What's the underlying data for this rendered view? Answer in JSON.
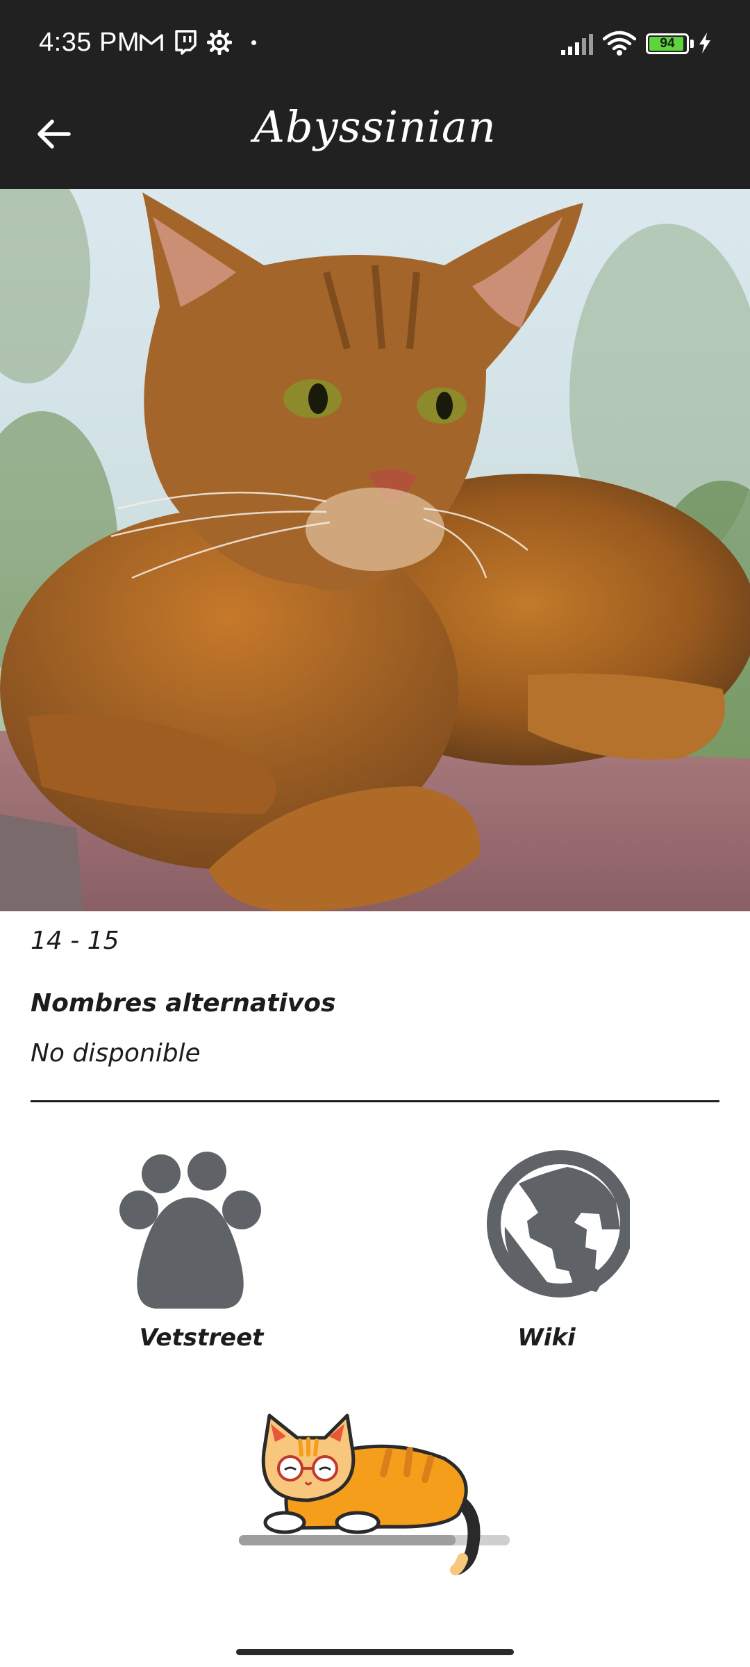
{
  "status_bar": {
    "time": "4:35 PM",
    "battery_level": "94",
    "battery_fraction": 0.94,
    "battery_color": "#5cd63b",
    "icons": [
      "gmail-icon",
      "twitch-icon",
      "settings-icon",
      "dot-icon",
      "signal-icon",
      "wifi-icon",
      "battery-icon",
      "charging-icon"
    ]
  },
  "app_bar": {
    "title": "Abyssinian",
    "background": "#212121",
    "back_icon": "arrow-back-icon"
  },
  "breed": {
    "photo_icon": "cat-photo",
    "life_span": "14 - 15",
    "alt_names_heading": "Nombres alternativos",
    "alt_names_value": "No disponible"
  },
  "links": {
    "vetstreet": {
      "label": "Vetstreet",
      "icon": "paw-icon"
    },
    "wiki": {
      "label": "Wiki",
      "icon": "globe-icon"
    },
    "icon_color": "#5f6368"
  },
  "loader": {
    "icon": "sleeping-cat-icon",
    "progress_fraction": 0.8
  }
}
